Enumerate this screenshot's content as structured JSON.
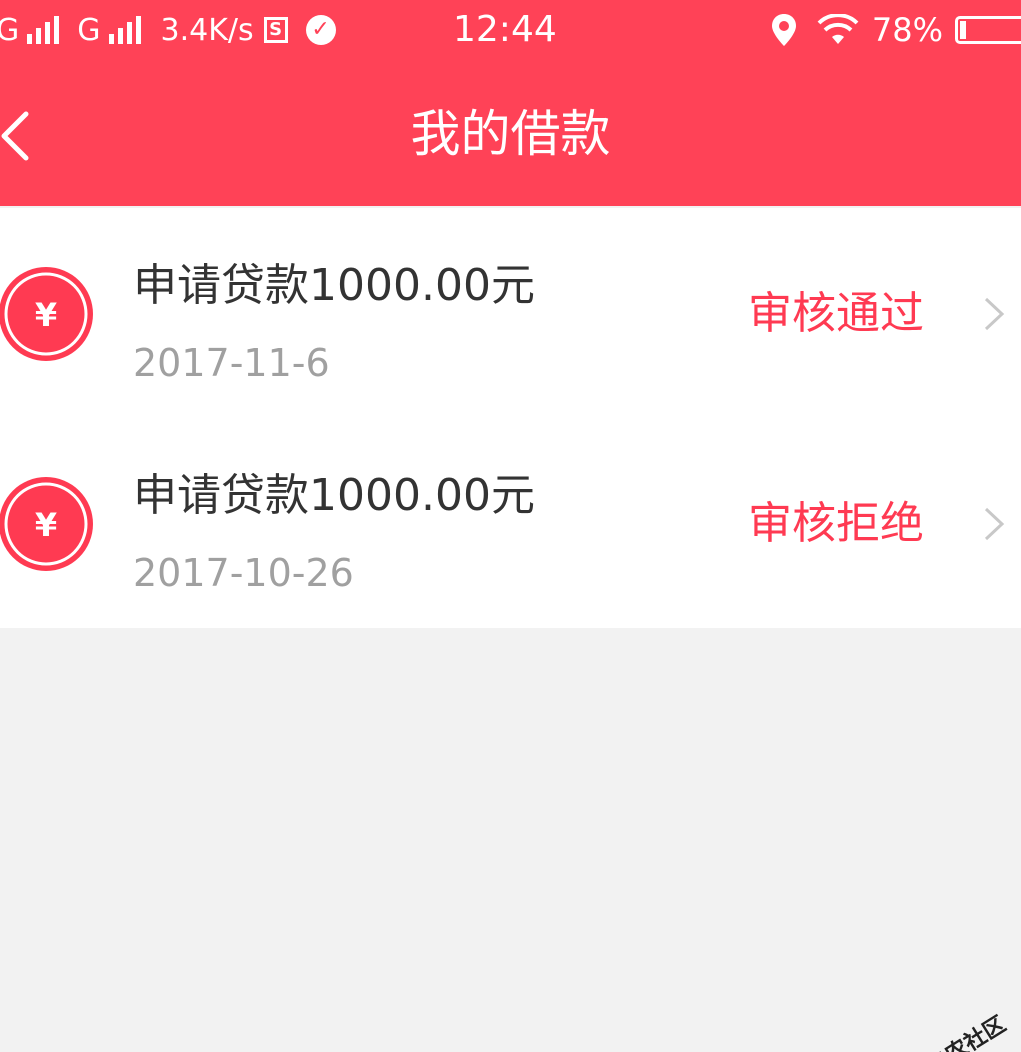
{
  "status_bar": {
    "signal1_label": "G",
    "signal2_label": "G",
    "net_speed": "3.4K/s",
    "s_badge": "S",
    "time": "12:44",
    "battery": "78%",
    "battery_level": 0.1
  },
  "nav": {
    "title": "我的借款"
  },
  "loans": [
    {
      "title": "申请贷款1000.00元",
      "date": "2017-11-6",
      "status": "审核通过"
    },
    {
      "title": "申请贷款1000.00元",
      "date": "2017-10-26",
      "status": "审核拒绝"
    }
  ],
  "icons": {
    "back": "back-arrow-icon",
    "yen": "yen-icon",
    "chevron": "chevron-right-icon",
    "location": "location-icon",
    "wifi": "wifi-icon"
  },
  "colors": {
    "brand": "#ff4257",
    "status_text": "#ff3a52",
    "title_text": "#333333",
    "date_text": "#a0a0a0",
    "background": "#f2f2f2"
  },
  "watermark": {
    "text": "卡农社区"
  }
}
